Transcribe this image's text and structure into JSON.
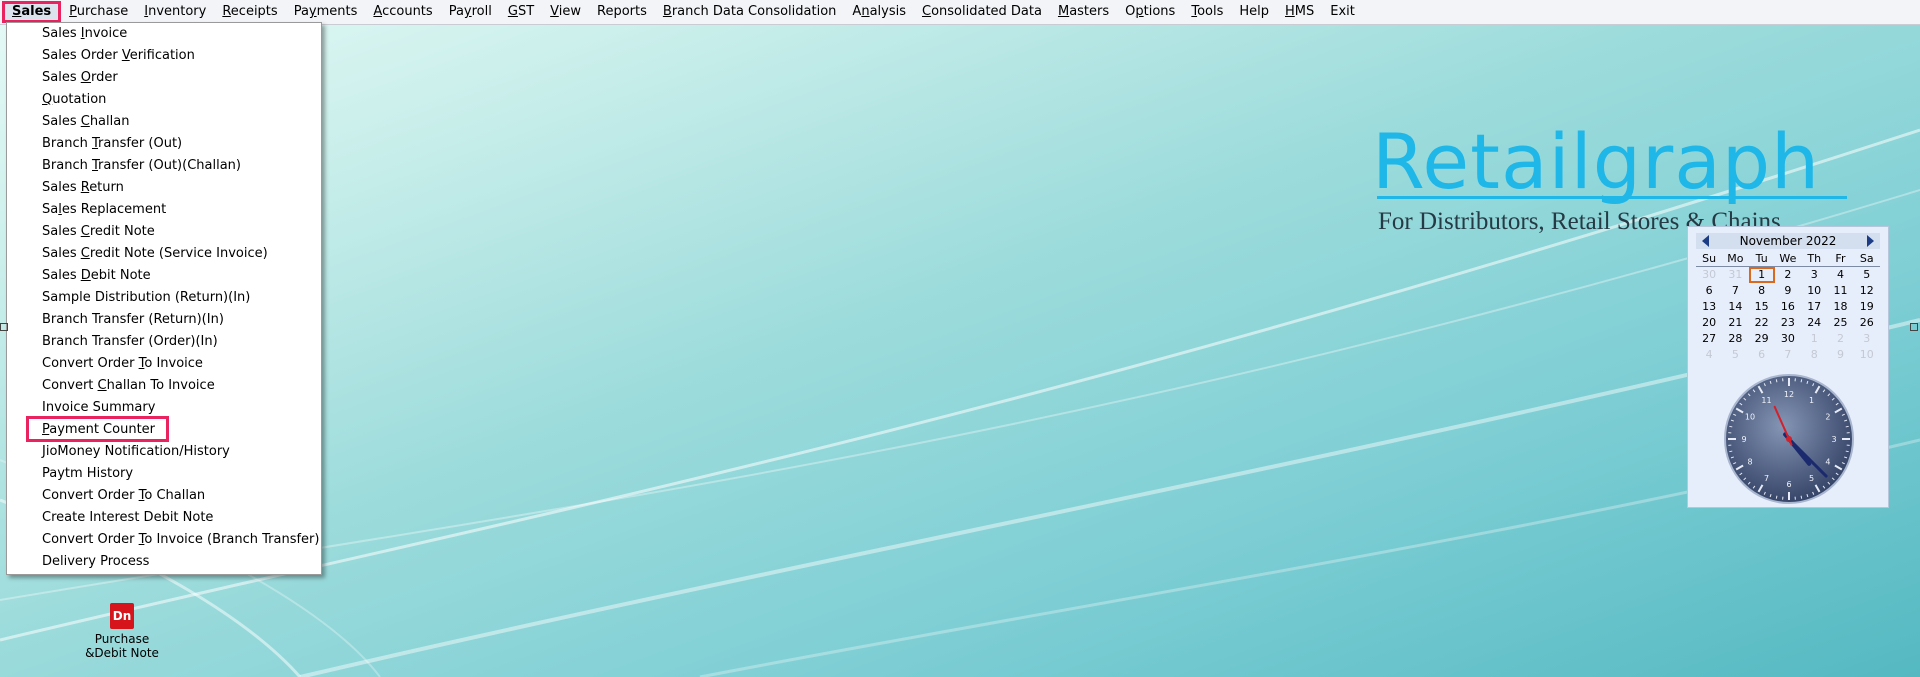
{
  "menubar": [
    {
      "pre": "",
      "u": "S",
      "post": "ales",
      "active": true
    },
    {
      "pre": "",
      "u": "P",
      "post": "urchase"
    },
    {
      "pre": "",
      "u": "I",
      "post": "nventory"
    },
    {
      "pre": "",
      "u": "R",
      "post": "eceipts"
    },
    {
      "pre": "Pa",
      "u": "y",
      "post": "ments"
    },
    {
      "pre": "",
      "u": "A",
      "post": "ccounts"
    },
    {
      "pre": "Pa",
      "u": "y",
      "post": "roll"
    },
    {
      "pre": "",
      "u": "G",
      "post": "ST"
    },
    {
      "pre": "",
      "u": "V",
      "post": "iew"
    },
    {
      "pre": "Reports",
      "u": "",
      "post": ""
    },
    {
      "pre": "",
      "u": "B",
      "post": "ranch Data Consolidation"
    },
    {
      "pre": "A",
      "u": "n",
      "post": "alysis"
    },
    {
      "pre": "",
      "u": "C",
      "post": "onsolidated Data"
    },
    {
      "pre": "",
      "u": "M",
      "post": "asters"
    },
    {
      "pre": "O",
      "u": "p",
      "post": "tions"
    },
    {
      "pre": "",
      "u": "T",
      "post": "ools"
    },
    {
      "pre": "Help",
      "u": "",
      "post": ""
    },
    {
      "pre": "",
      "u": "H",
      "post": "MS"
    },
    {
      "pre": "Exit",
      "u": "",
      "post": ""
    }
  ],
  "sales_menu": [
    {
      "pre": "Sales ",
      "u": "I",
      "post": "nvoice"
    },
    {
      "pre": "Sales Order ",
      "u": "V",
      "post": "erification"
    },
    {
      "pre": "Sales ",
      "u": "O",
      "post": "rder"
    },
    {
      "pre": "",
      "u": "Q",
      "post": "uotation"
    },
    {
      "pre": "Sales ",
      "u": "C",
      "post": "hallan"
    },
    {
      "pre": "Branch ",
      "u": "T",
      "post": "ransfer (Out)"
    },
    {
      "pre": "Branch ",
      "u": "T",
      "post": "ransfer (Out)(Challan)"
    },
    {
      "pre": "Sales ",
      "u": "R",
      "post": "eturn"
    },
    {
      "pre": "Sa",
      "u": "l",
      "post": "es Replacement"
    },
    {
      "pre": "Sales ",
      "u": "C",
      "post": "redit Note"
    },
    {
      "pre": "Sales ",
      "u": "C",
      "post": "redit Note (Service Invoice)"
    },
    {
      "pre": "Sales ",
      "u": "D",
      "post": "ebit Note"
    },
    {
      "pre": "Sample Distribution (Return)(In)",
      "u": "",
      "post": ""
    },
    {
      "pre": "Branch Transfer (Return)(In)",
      "u": "",
      "post": ""
    },
    {
      "pre": "Branch Transfer (Order)(In)",
      "u": "",
      "post": ""
    },
    {
      "pre": "Convert Order ",
      "u": "T",
      "post": "o Invoice"
    },
    {
      "pre": "Convert ",
      "u": "C",
      "post": "hallan To Invoice"
    },
    {
      "pre": "Invoice Summary",
      "u": "",
      "post": ""
    },
    {
      "pre": "",
      "u": "P",
      "post": "ayment Counter",
      "highlight": true
    },
    {
      "pre": "JioMoney Notification/History",
      "u": "",
      "post": ""
    },
    {
      "pre": "Paytm History",
      "u": "",
      "post": ""
    },
    {
      "pre": "Convert Order ",
      "u": "T",
      "post": "o Challan"
    },
    {
      "pre": "Create Interest Debit Note",
      "u": "",
      "post": ""
    },
    {
      "pre": "Convert Order ",
      "u": "T",
      "post": "o Invoice (Branch Transfer)"
    },
    {
      "pre": "Delivery Process",
      "u": "",
      "post": ""
    }
  ],
  "logo": {
    "title": "Retailgraph",
    "subtitle": "For Distributors, Retail Stores & Chains",
    "color": "#1fb6e8"
  },
  "calendar": {
    "month_year": "November  2022",
    "weekdays": [
      "Su",
      "Mo",
      "Tu",
      "We",
      "Th",
      "Fr",
      "Sa"
    ],
    "weeks": [
      [
        "30",
        "31",
        "1",
        "2",
        "3",
        "4",
        "5"
      ],
      [
        "6",
        "7",
        "8",
        "9",
        "10",
        "11",
        "12"
      ],
      [
        "13",
        "14",
        "15",
        "16",
        "17",
        "18",
        "19"
      ],
      [
        "20",
        "21",
        "22",
        "23",
        "24",
        "25",
        "26"
      ],
      [
        "27",
        "28",
        "29",
        "30",
        "1",
        "2",
        "3"
      ],
      [
        "4",
        "5",
        "6",
        "7",
        "8",
        "9",
        "10"
      ]
    ],
    "dim": [
      [
        0,
        0
      ],
      [
        0,
        1
      ],
      [
        4,
        4
      ],
      [
        4,
        5
      ],
      [
        4,
        6
      ],
      [
        5,
        0
      ],
      [
        5,
        1
      ],
      [
        5,
        2
      ],
      [
        5,
        3
      ],
      [
        5,
        4
      ],
      [
        5,
        5
      ],
      [
        5,
        6
      ]
    ],
    "today": [
      0,
      2
    ]
  },
  "clock": {
    "numerals": [
      "12",
      "1",
      "2",
      "3",
      "4",
      "5",
      "6",
      "7",
      "8",
      "9",
      "10",
      "11"
    ],
    "hour": 4.7,
    "minute": 22.5,
    "second": 56
  },
  "desktop_icon": {
    "glyph": "Dn",
    "label_line1": "Purchase",
    "label_line2": "&Debit Note"
  },
  "colors": {
    "highlight": "#e8235f",
    "accent": "#1fb6e8",
    "icon_red": "#d6141b"
  }
}
